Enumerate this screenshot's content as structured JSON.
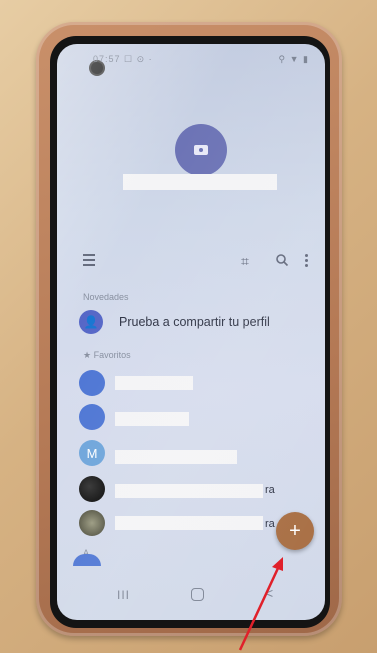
{
  "status_bar": {
    "left_text": "07:57 ☐ ⊙ ·",
    "right_text": "⚲ ▼ ▮"
  },
  "toolbar": {
    "menu_icon": "menu-icon",
    "scan_icon": "qr-scan-icon",
    "search_icon": "search-icon",
    "more_icon": "more-vert-icon"
  },
  "sections": {
    "news": "Novedades",
    "favorites": "Favoritos",
    "index_letter": "A"
  },
  "share_profile": {
    "label": "Prueba a compartir tu perfil"
  },
  "contacts": [
    {
      "initial": "",
      "suffix": ""
    },
    {
      "initial": "",
      "suffix": ""
    },
    {
      "initial": "M",
      "suffix": ""
    },
    {
      "initial": "",
      "suffix": "ra"
    },
    {
      "initial": "",
      "suffix": "ra"
    }
  ],
  "fab": {
    "label": "+"
  },
  "nav": {
    "recents": "III",
    "home": "",
    "back": "<"
  },
  "colors": {
    "accent": "#5667c7",
    "fab": "#a86e43",
    "arrow": "#e0202a"
  }
}
